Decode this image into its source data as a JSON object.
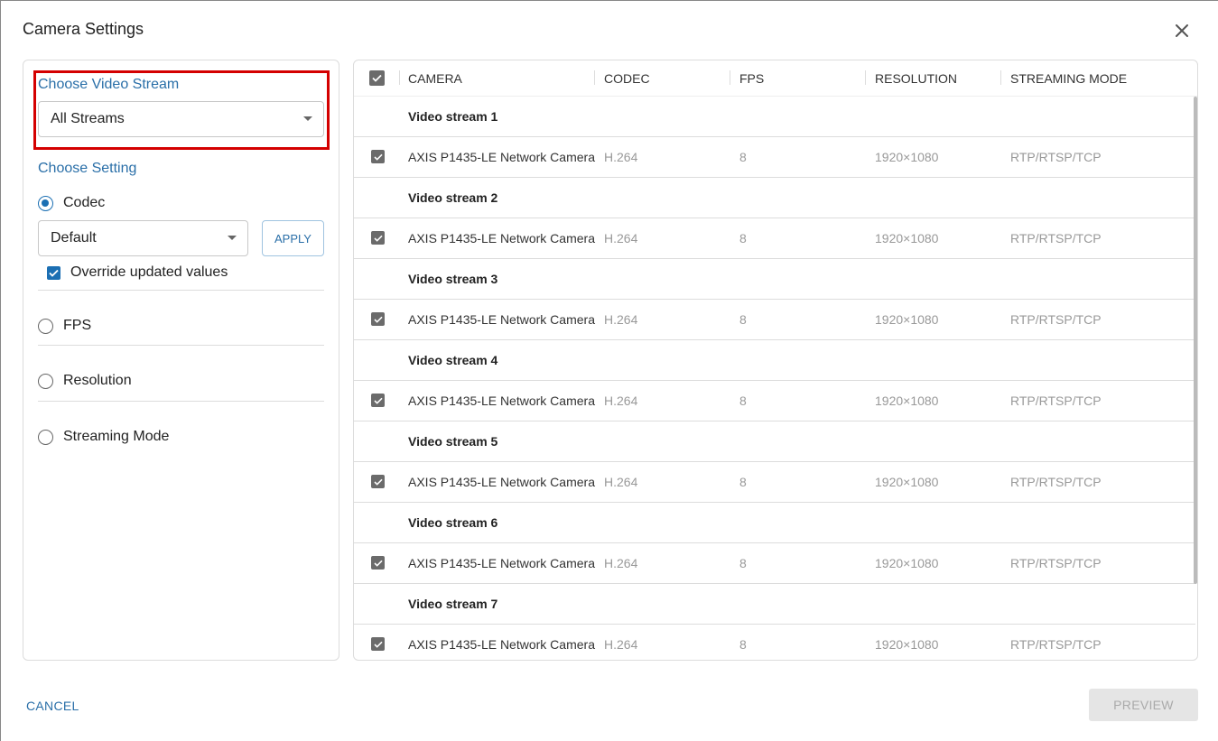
{
  "dialog": {
    "title": "Camera Settings"
  },
  "left": {
    "video_stream_label": "Choose Video Stream",
    "video_stream_value": "All Streams",
    "setting_label": "Choose Setting",
    "options": [
      {
        "label": "Codec",
        "selected": true
      },
      {
        "label": "FPS",
        "selected": false
      },
      {
        "label": "Resolution",
        "selected": false
      },
      {
        "label": "Streaming Mode",
        "selected": false
      }
    ],
    "codec_value": "Default",
    "apply_label": "APPLY",
    "override_label": "Override updated values",
    "override_checked": true
  },
  "table": {
    "headers": [
      "CAMERA",
      "CODEC",
      "FPS",
      "RESOLUTION",
      "STREAMING MODE"
    ],
    "groups": [
      {
        "name": "Video stream 1",
        "camera": "AXIS P1435-LE Network Camera",
        "codec": "H.264",
        "fps": "8",
        "resolution": "1920×1080",
        "mode": "RTP/RTSP/TCP"
      },
      {
        "name": "Video stream 2",
        "camera": "AXIS P1435-LE Network Camera",
        "codec": "H.264",
        "fps": "8",
        "resolution": "1920×1080",
        "mode": "RTP/RTSP/TCP"
      },
      {
        "name": "Video stream 3",
        "camera": "AXIS P1435-LE Network Camera",
        "codec": "H.264",
        "fps": "8",
        "resolution": "1920×1080",
        "mode": "RTP/RTSP/TCP"
      },
      {
        "name": "Video stream 4",
        "camera": "AXIS P1435-LE Network Camera",
        "codec": "H.264",
        "fps": "8",
        "resolution": "1920×1080",
        "mode": "RTP/RTSP/TCP"
      },
      {
        "name": "Video stream 5",
        "camera": "AXIS P1435-LE Network Camera",
        "codec": "H.264",
        "fps": "8",
        "resolution": "1920×1080",
        "mode": "RTP/RTSP/TCP"
      },
      {
        "name": "Video stream 6",
        "camera": "AXIS P1435-LE Network Camera",
        "codec": "H.264",
        "fps": "8",
        "resolution": "1920×1080",
        "mode": "RTP/RTSP/TCP"
      },
      {
        "name": "Video stream 7",
        "camera": "AXIS P1435-LE Network Camera",
        "codec": "H.264",
        "fps": "8",
        "resolution": "1920×1080",
        "mode": "RTP/RTSP/TCP"
      }
    ]
  },
  "footer": {
    "cancel_label": "CANCEL",
    "preview_label": "PREVIEW"
  },
  "icons": {
    "close": "close-icon",
    "dropdown": "caret-down-icon",
    "checkbox": "checkmark-icon"
  },
  "colors": {
    "accent": "#1b6fb3",
    "link": "#2a6fa8",
    "highlight_border": "#d40000"
  }
}
